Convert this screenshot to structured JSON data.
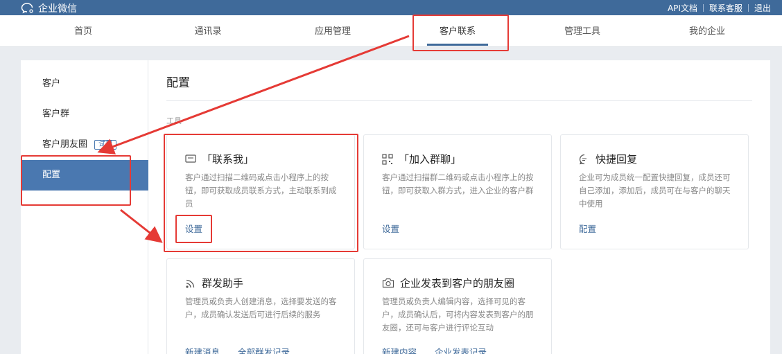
{
  "topbar": {
    "brand": "企业微信",
    "links": [
      "API文档",
      "联系客服",
      "退出"
    ]
  },
  "nav": {
    "items": [
      "首页",
      "通讯录",
      "应用管理",
      "客户联系",
      "管理工具",
      "我的企业"
    ],
    "active": "客户联系"
  },
  "sidebar": {
    "items": [
      "客户",
      "客户群",
      "客户朋友圈",
      "配置"
    ],
    "badge": "试用",
    "active": "配置"
  },
  "main": {
    "title": "配置",
    "section_label": "工具",
    "cards": [
      {
        "icon": "message-icon",
        "title": "「联系我」",
        "desc": "客户通过扫描二维码或点击小程序上的按钮，即可获取成员联系方式，主动联系到成员",
        "links": [
          "设置"
        ]
      },
      {
        "icon": "qrcode-icon",
        "title": "「加入群聊」",
        "desc": "客户通过扫描群二维码或点击小程序上的按钮，即可获取入群方式，进入企业的客户群",
        "links": [
          "设置"
        ]
      },
      {
        "icon": "chat-bubble-icon",
        "title": "快捷回复",
        "desc": "企业可为成员统一配置快捷回复，成员还可自己添加，添加后，成员可在与客户的聊天中使用",
        "links": [
          "配置"
        ]
      },
      {
        "icon": "broadcast-icon",
        "title": "群发助手",
        "desc": "管理员或负责人创建消息，选择要发送的客户，成员确认发送后可进行后续的服务",
        "links": [
          "新建消息",
          "全部群发记录"
        ]
      },
      {
        "icon": "camera-icon",
        "title": "企业发表到客户的朋友圈",
        "desc": "管理员或负责人编辑内容，选择可见的客户，成员确认后，可将内容发表到客户的朋友圈，还可与客户进行评论互动",
        "links": [
          "新建内容",
          "企业发表记录"
        ]
      }
    ]
  },
  "colors": {
    "topbar": "#3f6a9a",
    "accent": "#4a78b0",
    "link": "#3f6a9a",
    "annotation": "#e53a35"
  }
}
